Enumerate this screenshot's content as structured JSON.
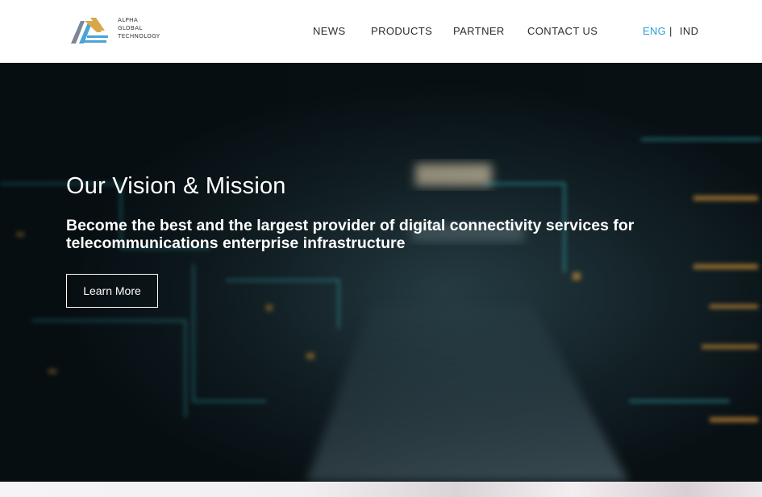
{
  "header": {
    "logo": {
      "lines": [
        "ALPHA",
        "GLOBAL",
        "TECHNOLOGY"
      ]
    },
    "nav": [
      {
        "label": "NEWS"
      },
      {
        "label": "PRODUCTS"
      },
      {
        "label": "PARTNER"
      },
      {
        "label": "CONTACT US"
      }
    ],
    "language": {
      "active": "ENG",
      "separator": "|",
      "other": "IND"
    }
  },
  "hero": {
    "title": "Our Vision & Mission",
    "subtitle": "Become the best and the largest provider of digital connectivity services for telecommunications enterprise infrastructure",
    "button_label": "Learn More"
  },
  "colors": {
    "accent": "#2a9fd6",
    "logo_gold": "#d8a74a",
    "logo_blue": "#4aa3d8",
    "logo_grey": "#7c8796"
  }
}
